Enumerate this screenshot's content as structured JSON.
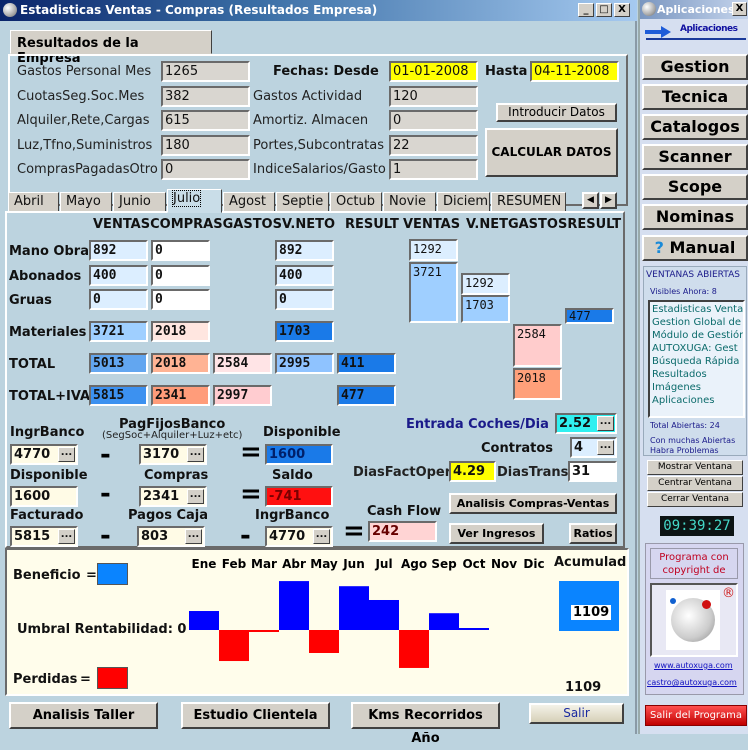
{
  "window": {
    "title": "Estadisticas Ventas - Compras (Resultados Empresa)",
    "min": "_",
    "max": "□",
    "close": "X"
  },
  "group_tab": "Resultados de la Empresa",
  "left_fields": [
    {
      "label": "Gastos Personal Mes",
      "value": "1265"
    },
    {
      "label": "CuotasSeg.Soc.Mes",
      "value": "382"
    },
    {
      "label": "Alquiler,Rete,Cargas",
      "value": "615"
    },
    {
      "label": "Luz,Tfno,Suministros",
      "value": "180"
    },
    {
      "label": "ComprasPagadasOtro",
      "value": "0"
    }
  ],
  "mid_fields": [
    {
      "label": "Gastos Actividad",
      "value": "120"
    },
    {
      "label": "Amortiz. Almacen",
      "value": "0"
    },
    {
      "label": "Portes,Subcontratas",
      "value": "22"
    },
    {
      "label": "IndiceSalarios/Gasto",
      "value": "1"
    }
  ],
  "dates": {
    "desde_label": "Fechas: Desde",
    "desde": "01-01-2008",
    "hasta_label": "Hasta",
    "hasta": "04-11-2008"
  },
  "buttons": {
    "introducir": "Introducir Datos",
    "calcular": "CALCULAR DATOS",
    "analisis_cv": "Analisis Compras-Ventas",
    "ver_ingresos": "Ver Ingresos",
    "ratios": "Ratios",
    "analisis_taller": "Analisis Taller",
    "estudio_clientela": "Estudio Clientela",
    "kms": "Kms Recorridos Año",
    "salir": "Salir"
  },
  "month_tabs": [
    "Abril",
    "Mayo",
    "Junio",
    "Julio",
    "Agost",
    "Septie",
    "Octub",
    "Novie",
    "Diciem",
    "RESUMEN"
  ],
  "active_tab": "Julio",
  "columns_left": {
    "header": "VENTASCOMPRASGASTOS",
    "vneto": "V.NETO",
    "result": "RESULT"
  },
  "columns_right": {
    "ventas": "VENTAS",
    "header2": "V.NETGASTOSRESULT"
  },
  "rows": [
    {
      "label": "Mano Obra",
      "ventas": "892",
      "compras": "0",
      "vneto": "892"
    },
    {
      "label": "Abonados",
      "ventas": "400",
      "compras": "0",
      "vneto": "400"
    },
    {
      "label": "Gruas",
      "ventas": "0",
      "compras": "0",
      "vneto": "0"
    },
    {
      "label": "Materiales",
      "ventas": "3721",
      "compras": "2018",
      "vneto": "1703"
    },
    {
      "label": "TOTAL",
      "ventas": "5013",
      "compras": "2018",
      "gastos": "2584",
      "vneto": "2995",
      "result": "411"
    },
    {
      "label": "TOTAL+IVA",
      "ventas": "5815",
      "compras": "2341",
      "gastos": "2997",
      "result": "477"
    }
  ],
  "waterfall": {
    "ventas_top": "1292",
    "ventas_bottom": "3721",
    "vnet_top": "1292",
    "vnet_bottom": "1703",
    "gastos_top": "2584",
    "gastos_bottom": "2018",
    "result": "477"
  },
  "cash": {
    "ingr_banco_label": "IngrBanco",
    "ingr_banco": "4770",
    "pagfijos_label": "PagFijosBanco",
    "pagfijos_sub": "(SegSoc+Alquiler+Luz+etc)",
    "pagfijos": "3170",
    "disponible_label": "Disponible",
    "disponible": "1600",
    "disp2_label": "Disponible",
    "disp2": "1600",
    "compras_label": "Compras",
    "compras": "2341",
    "saldo_label": "Saldo",
    "saldo": "-741",
    "facturado_label": "Facturado",
    "facturado": "5815",
    "pagos_caja_label": "Pagos Caja",
    "pagos_caja": "803",
    "ingr2_label": "IngrBanco",
    "ingr2": "4770",
    "cashflow_label": "Cash Flow",
    "cashflow": "242",
    "minus": "-",
    "equals": "="
  },
  "stats": {
    "entrada_label": "Entrada Coches/Dia",
    "entrada": "2.52",
    "contratos_label": "Contratos",
    "contratos": "4",
    "diasfact_label": "DiasFactOper",
    "diasfact": "4.29",
    "diastrans_label": "DiasTrans",
    "diastrans": "31"
  },
  "chart_data": {
    "type": "bar",
    "title": "",
    "categories": [
      "Ene",
      "Feb",
      "Mar",
      "Abr",
      "May",
      "Jun",
      "Jul",
      "Ago",
      "Sep",
      "Oct",
      "Nov",
      "Dic"
    ],
    "values": [
      260,
      -425,
      -25,
      670,
      -315,
      600,
      411,
      -520,
      230,
      15,
      null,
      null
    ],
    "legend": [
      {
        "name": "Beneficio",
        "color": "#0a84ff"
      },
      {
        "name": "Perdidas",
        "color": "#ff0000"
      }
    ],
    "bar_colors": {
      "positive": "#0000ff",
      "negative": "#ff0000"
    },
    "threshold_label": "Umbral Rentabilidad: 0",
    "accum_label": "Acumulad",
    "accum_value": "1109",
    "accum_total": "1109"
  },
  "right_panel": {
    "title": "Aplicaciones",
    "close": "X",
    "header_link": "Aplicaciones",
    "buttons": [
      "Gestion",
      "Tecnica",
      "Catalogos",
      "Scanner",
      "Scope",
      "Nominas",
      "Manual"
    ],
    "open_title": "VENTANAS ABIERTAS",
    "visibles": "Visibles Ahora: 8",
    "windows": [
      "Estadisticas Ventas",
      "Gestion Global de T",
      "Módulo de Gestión",
      "AUTOXUGA:  Gest",
      "Búsqueda Rápida",
      "Resultados",
      "Imágenes",
      "Aplicaciones"
    ],
    "total": "Total Abiertas: 24",
    "warning": "Con muchas Abiertas Habra Problemas",
    "win_buttons": [
      "Mostrar Ventana",
      "Centrar Ventana",
      "Cerrar Ventana"
    ],
    "clock": "09:39:27",
    "copyright": "Programa con copyright de",
    "web": "www.autoxuga.com",
    "email": "castro@autoxuga.com",
    "exit": "Salir del Programa"
  }
}
